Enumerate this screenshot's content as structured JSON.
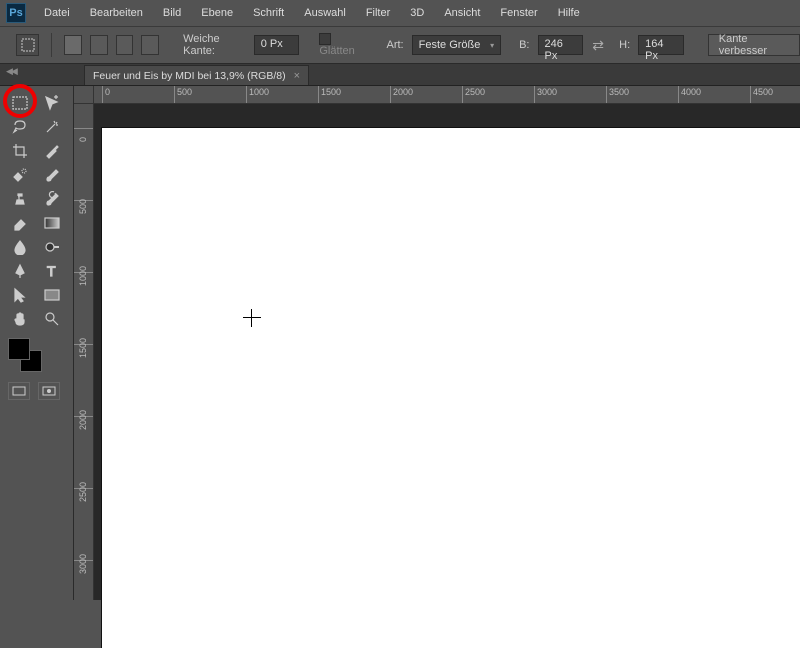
{
  "app": {
    "logo": "Ps"
  },
  "menu": [
    "Datei",
    "Bearbeiten",
    "Bild",
    "Ebene",
    "Schrift",
    "Auswahl",
    "Filter",
    "3D",
    "Ansicht",
    "Fenster",
    "Hilfe"
  ],
  "options": {
    "feather_label": "Weiche Kante:",
    "feather_value": "0 Px",
    "antialias_label": "Glätten",
    "style_label": "Art:",
    "style_value": "Feste Größe",
    "width_label": "B:",
    "width_value": "246 Px",
    "height_label": "H:",
    "height_value": "164 Px",
    "refine_button": "Kante verbesser"
  },
  "tab": {
    "title": "Feuer und Eis by MDI bei 13,9% (RGB/8)",
    "close": "×"
  },
  "ruler": {
    "h_labels": [
      "0",
      "500",
      "1000",
      "1500",
      "2000",
      "2500",
      "3000",
      "3500",
      "4000",
      "4500"
    ],
    "v_labels": [
      "0",
      "500",
      "1000",
      "1500",
      "2000",
      "2500",
      "3000"
    ]
  },
  "tools": {
    "left_col": [
      "marquee",
      "lasso",
      "crop",
      "eyedropper-adv",
      "healing",
      "clone",
      "eraser",
      "blur",
      "pen",
      "pointer",
      "hand"
    ],
    "right_col": [
      "move",
      "wand",
      "eyedropper",
      "brush-adv",
      "brush",
      "history",
      "gradient",
      "dodge",
      "text",
      "shape",
      "zoom"
    ]
  }
}
